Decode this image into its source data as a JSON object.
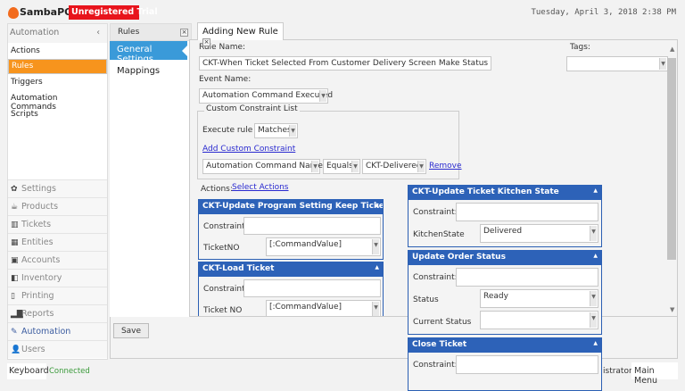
{
  "header": {
    "brand": "SambaPOS",
    "badge": "Unregistered Trial",
    "datetime": "Tuesday, April 3, 2018 2:38 PM"
  },
  "left_panel": {
    "title": "Automation",
    "items": [
      {
        "label": "Actions"
      },
      {
        "label": "Rules",
        "selected": true
      },
      {
        "label": "Triggers"
      },
      {
        "label": "Automation Commands"
      },
      {
        "label": "Scripts"
      }
    ],
    "nav": [
      {
        "label": "Settings",
        "icon": "gear-icon"
      },
      {
        "label": "Products",
        "icon": "coffee-icon"
      },
      {
        "label": "Tickets",
        "icon": "books-icon"
      },
      {
        "label": "Entities",
        "icon": "table-icon"
      },
      {
        "label": "Accounts",
        "icon": "calculator-icon"
      },
      {
        "label": "Inventory",
        "icon": "boxes-icon"
      },
      {
        "label": "Printing",
        "icon": "document-icon"
      },
      {
        "label": "Reports",
        "icon": "bar-chart-icon"
      },
      {
        "label": "Automation",
        "icon": "pen-icon",
        "active": true
      },
      {
        "label": "Users",
        "icon": "user-icon"
      }
    ]
  },
  "middle": {
    "tab": "Rules",
    "items": [
      "General Settings",
      "Mappings"
    ]
  },
  "editor": {
    "tab": "Adding New Rule",
    "rule_name_label": "Rule Name:",
    "rule_name": "CKT-When Ticket Selected From Customer Delivery Screen Make Status Delivered",
    "tags_label": "Tags:",
    "tags_value": "",
    "event_name_label": "Event Name:",
    "event_name": "Automation Command Executed",
    "constraints": {
      "title": "Custom Constraint List",
      "execute_label": "Execute rule if",
      "execute_value": "Matches",
      "add_link": "Add Custom Constraint",
      "row": {
        "field": "Automation Command Name",
        "operator": "Equals",
        "value": "CKT-Delivered",
        "remove": "Remove"
      }
    },
    "actions_label": "Actions:",
    "select_actions": "Select Actions",
    "actions_left": [
      {
        "title": "CKT-Update Program Setting Keep Ticket No",
        "constraint_label": "Constraint:",
        "params": [
          {
            "label": "TicketNO",
            "value": "[:CommandValue]"
          }
        ]
      },
      {
        "title": "CKT-Load Ticket",
        "constraint_label": "Constraint:",
        "params": [
          {
            "label": "Ticket NO",
            "value": "[:CommandValue]"
          }
        ]
      }
    ],
    "actions_right": [
      {
        "title": "CKT-Update Ticket Kitchen State",
        "constraint_label": "Constraint:",
        "params": [
          {
            "label": "KitchenState",
            "value": "Delivered"
          }
        ]
      },
      {
        "title": "Update Order Status",
        "constraint_label": "Constraint:",
        "params": [
          {
            "label": "Status",
            "value": "Ready"
          },
          {
            "label": "Current Status",
            "value": ""
          }
        ]
      },
      {
        "title": "Close Ticket",
        "constraint_label": "Constraint:",
        "params": []
      }
    ],
    "save": "Save"
  },
  "status": {
    "keyboard": "Keyboard",
    "connection": "Connected",
    "user": "istrator",
    "main_menu": "Main Menu"
  },
  "colors": {
    "accent_orange": "#f7941d",
    "selected_blue": "#3a9ad9",
    "card_header": "#2d62b8",
    "badge_red": "#e8141c"
  }
}
